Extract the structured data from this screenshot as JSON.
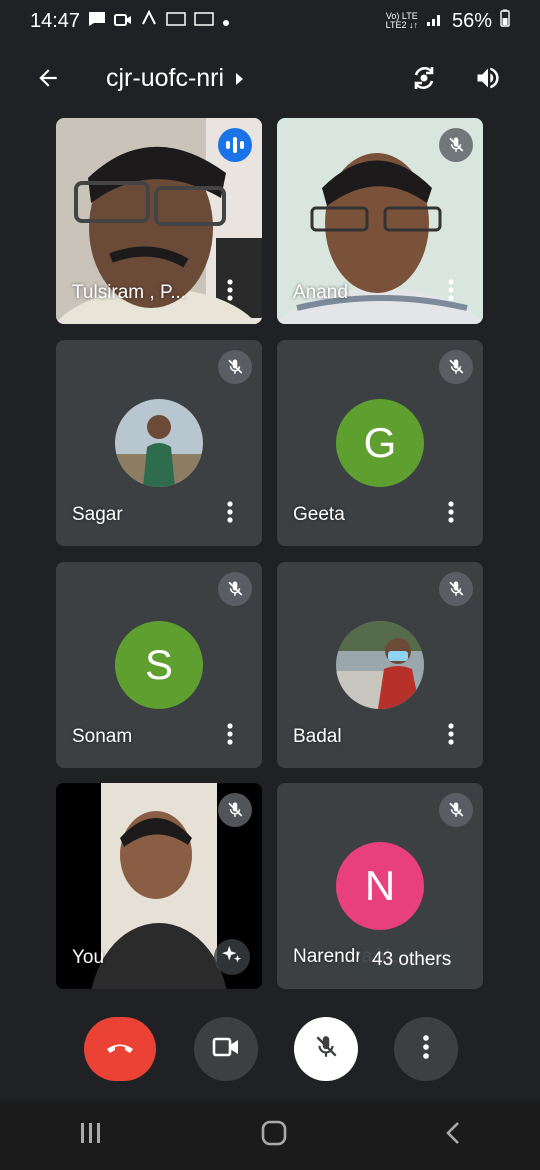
{
  "status": {
    "time": "14:47",
    "network_top": "Vo) LTE",
    "network_bottom": "LTE2 ↓↑",
    "battery": "56%"
  },
  "header": {
    "meeting_name": "cjr-uofc-nri"
  },
  "participants": [
    {
      "name": "Tulsiram , P...",
      "type": "video",
      "state": "speaking"
    },
    {
      "name": "Anand",
      "type": "video",
      "state": "muted"
    },
    {
      "name": "Sagar",
      "type": "photo",
      "state": "muted"
    },
    {
      "name": "Geeta",
      "type": "letter",
      "letter": "G",
      "color": "#5f9f2f",
      "state": "muted"
    },
    {
      "name": "Sonam",
      "type": "letter",
      "letter": "S",
      "color": "#5f9f2f",
      "state": "muted"
    },
    {
      "name": "Badal",
      "type": "photo",
      "state": "muted"
    },
    {
      "name": "You",
      "type": "video",
      "state": "muted"
    },
    {
      "name": "Narendra Y...",
      "type": "letter",
      "letter": "N",
      "color": "#e8407a",
      "state": "muted"
    }
  ],
  "others_label": "43 others",
  "controls": {
    "end_call_color": "#ea4335",
    "mic_button_bg": "#ffffff"
  }
}
